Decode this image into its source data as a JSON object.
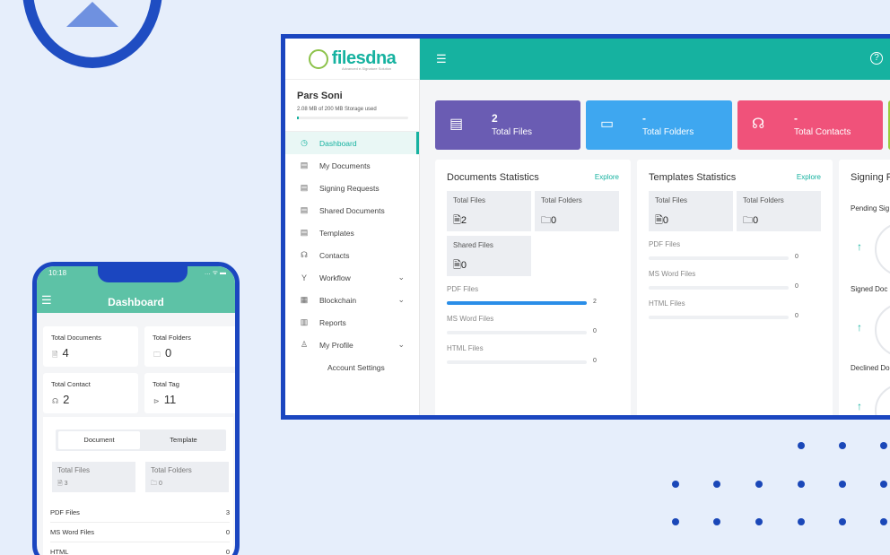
{
  "desktop": {
    "logo": {
      "text": "filesdna",
      "tagline": "Advanced e-Signature Solution"
    },
    "user": {
      "name": "Pars Soni",
      "storage": "2.08 MB of 200 MB Storage used",
      "storage_fraction": 0.0104
    },
    "menu": [
      {
        "label": "Dashboard",
        "icon": "dashboard-icon"
      },
      {
        "label": "My Documents",
        "icon": "document-icon"
      },
      {
        "label": "Signing Requests",
        "icon": "signing-icon"
      },
      {
        "label": "Shared Documents",
        "icon": "shared-icon"
      },
      {
        "label": "Templates",
        "icon": "template-icon"
      },
      {
        "label": "Contacts",
        "icon": "contacts-icon"
      },
      {
        "label": "Workflow",
        "icon": "workflow-icon"
      },
      {
        "label": "Blockchain",
        "icon": "blockchain-icon"
      },
      {
        "label": "Reports",
        "icon": "reports-icon"
      },
      {
        "label": "My Profile",
        "icon": "profile-icon"
      },
      {
        "label": "Account Settings"
      }
    ],
    "cards": [
      {
        "value": "2",
        "label": "Total Files",
        "color": "#6a5cb3"
      },
      {
        "value": "-",
        "label": "Total Folders",
        "color": "#3ea7f0"
      },
      {
        "value": "-",
        "label": "Total Contacts",
        "color": "#f0527a"
      }
    ],
    "documents": {
      "title": "Documents Statistics",
      "explore": "Explore",
      "total_files_label": "Total Files",
      "total_files": "2",
      "total_folders_label": "Total Folders",
      "total_folders": "0",
      "shared_files_label": "Shared Files",
      "shared_files": "0",
      "rows": [
        {
          "label": "PDF Files",
          "value": "2",
          "fraction": 1
        },
        {
          "label": "MS Word Files",
          "value": "0",
          "fraction": 0
        },
        {
          "label": "HTML Files",
          "value": "0",
          "fraction": 0
        }
      ]
    },
    "templates": {
      "title": "Templates Statistics",
      "explore": "Explore",
      "total_files_label": "Total Files",
      "total_files": "0",
      "total_folders_label": "Total Folders",
      "total_folders": "0",
      "rows": [
        {
          "label": "PDF Files",
          "value": "0",
          "fraction": 0
        },
        {
          "label": "MS Word Files",
          "value": "0",
          "fraction": 0
        },
        {
          "label": "HTML Files",
          "value": "0",
          "fraction": 0
        }
      ]
    },
    "signing": {
      "title": "Signing R",
      "items": [
        "Pending Sig",
        "Signed Doc",
        "Declined Do"
      ]
    }
  },
  "phone": {
    "time": "10:18",
    "title": "Dashboard",
    "cards": [
      {
        "label": "Total Documents",
        "value": "4"
      },
      {
        "label": "Total Folders",
        "value": "0"
      },
      {
        "label": "Total Contact",
        "value": "2"
      },
      {
        "label": "Total Tag",
        "value": "11"
      }
    ],
    "tabs": [
      "Document",
      "Template"
    ],
    "total_files_label": "Total Files",
    "total_files": "3",
    "total_folders_label": "Total Folders",
    "total_folders": "0",
    "rows": [
      {
        "label": "PDF Files",
        "value": "3"
      },
      {
        "label": "MS Word Files",
        "value": "0"
      },
      {
        "label": "HTML",
        "value": "0"
      }
    ]
  }
}
